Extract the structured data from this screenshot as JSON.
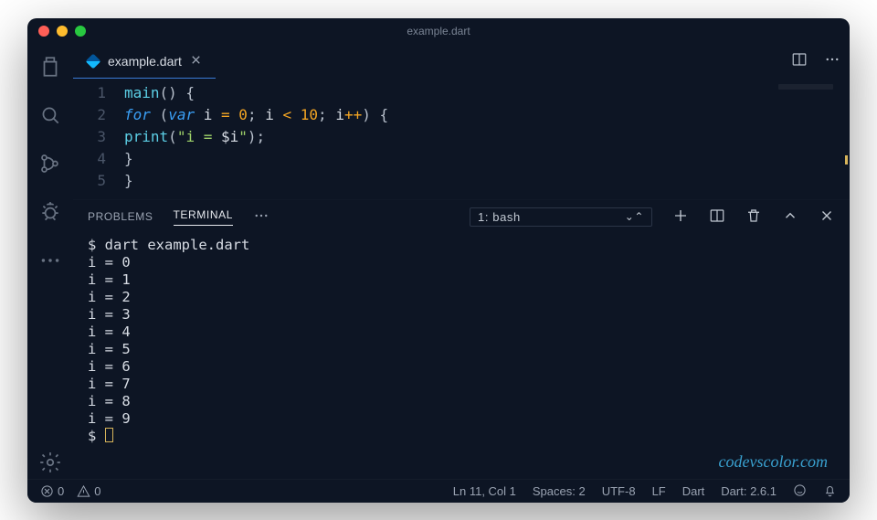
{
  "window": {
    "title": "example.dart"
  },
  "tab": {
    "filename": "example.dart"
  },
  "code": {
    "lines": [
      "1",
      "2",
      "3",
      "4",
      "5"
    ]
  },
  "panel": {
    "tabs": {
      "problems": "PROBLEMS",
      "terminal": "TERMINAL"
    },
    "terminalSelect": "1: bash"
  },
  "terminal_command": "dart example.dart",
  "terminal_output": [
    "i = 0",
    "i = 1",
    "i = 2",
    "i = 3",
    "i = 4",
    "i = 5",
    "i = 6",
    "i = 7",
    "i = 8",
    "i = 9"
  ],
  "status": {
    "errors": "0",
    "warnings": "0",
    "cursor": "Ln 11, Col 1",
    "spaces": "Spaces: 2",
    "encoding": "UTF-8",
    "eol": "LF",
    "lang": "Dart",
    "sdk": "Dart: 2.6.1"
  },
  "watermark": "codevscolor.com"
}
